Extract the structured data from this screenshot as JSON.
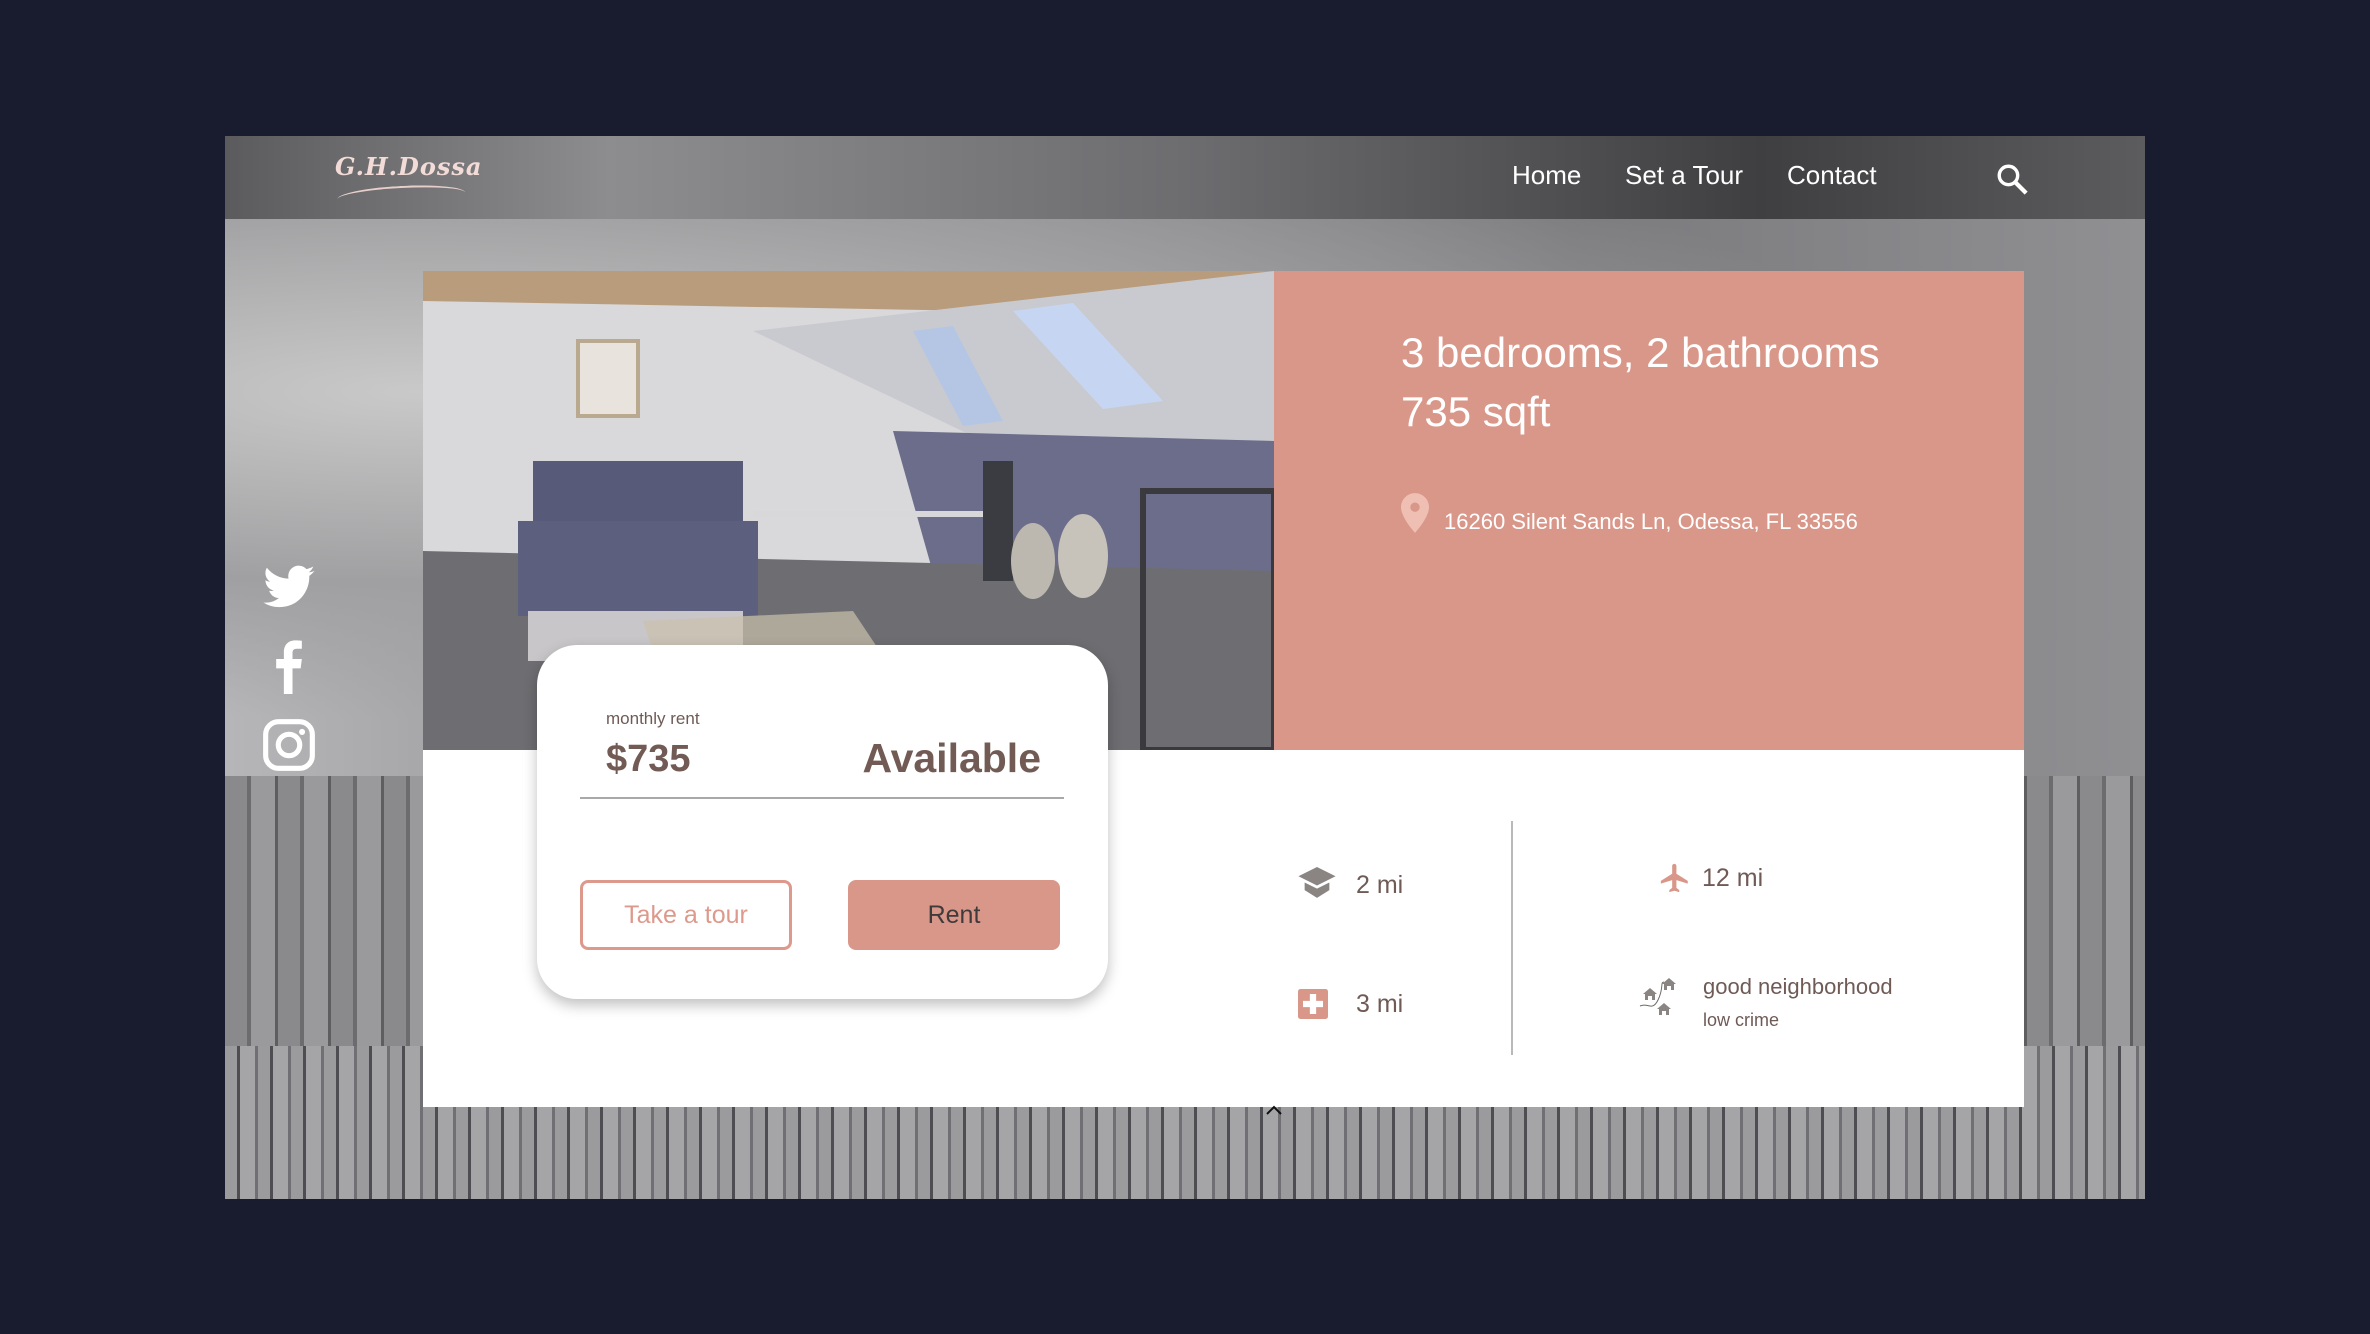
{
  "header": {
    "logo": "G.H.Dossa",
    "nav": [
      "Home",
      "Set a Tour",
      "Contact"
    ],
    "search_icon": "search-icon"
  },
  "social": [
    "twitter-icon",
    "facebook-icon",
    "instagram-icon"
  ],
  "listing": {
    "title_line1": "3 bedrooms, 2 bathrooms",
    "title_line2": "735 sqft",
    "address": "16260 Silent Sands Ln, Odessa, FL 33556"
  },
  "card": {
    "label": "monthly rent",
    "price": "$735",
    "status": "Available",
    "tour_button": "Take a tour",
    "rent_button": "Rent"
  },
  "amenities": {
    "school": "2 mi",
    "hospital": "3 mi",
    "airport": "12 mi",
    "neighborhood": "good neighborhood",
    "crime": "low crime"
  },
  "colors": {
    "accent": "#d99789",
    "background": "#191c2f",
    "text": "#735b55"
  }
}
